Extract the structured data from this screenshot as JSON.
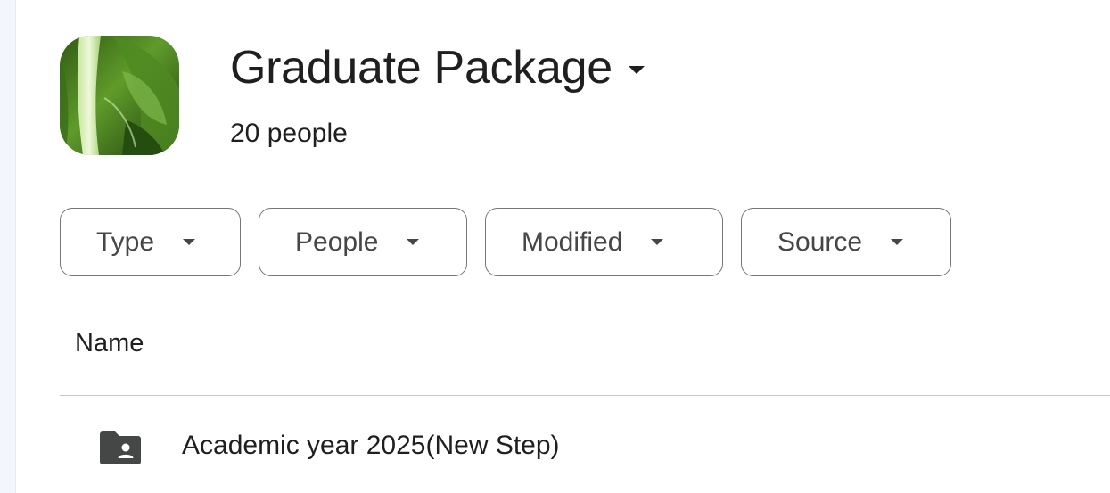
{
  "drive": {
    "title": "Graduate Package",
    "member_count": "20 people",
    "avatar_icon": "leaf-photo"
  },
  "filters": [
    {
      "label": "Type"
    },
    {
      "label": "People"
    },
    {
      "label": "Modified"
    },
    {
      "label": "Source"
    }
  ],
  "list": {
    "columns": {
      "name": "Name"
    },
    "rows": [
      {
        "name": "Academic year 2025(New Step)",
        "icon": "shared-folder-icon"
      }
    ]
  },
  "colors": {
    "text": "#1f1f1f",
    "chip_border": "#747775",
    "chip_text": "#444746",
    "divider": "#c4c7c5",
    "folder": "#444746"
  }
}
